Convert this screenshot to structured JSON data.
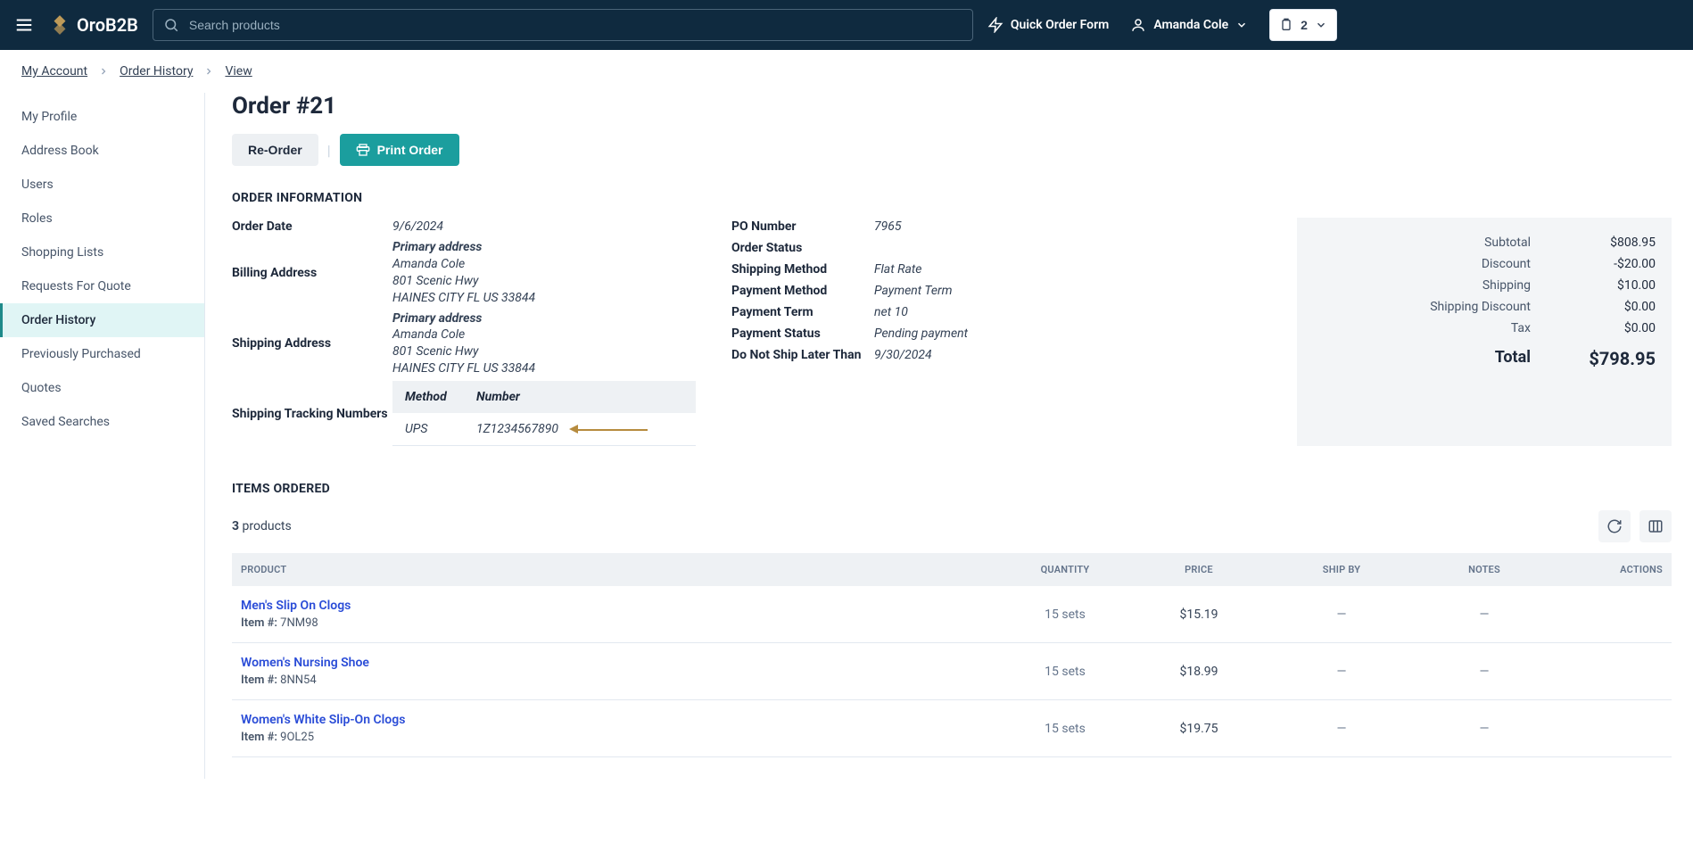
{
  "header": {
    "brand": "OroB2B",
    "search_placeholder": "Search products",
    "quick_order": "Quick Order Form",
    "user_name": "Amanda Cole",
    "cart_count": "2"
  },
  "breadcrumb": {
    "items": [
      "My Account",
      "Order History",
      "View"
    ]
  },
  "sidebar": {
    "items": [
      {
        "label": "My Profile"
      },
      {
        "label": "Address Book"
      },
      {
        "label": "Users"
      },
      {
        "label": "Roles"
      },
      {
        "label": "Shopping Lists"
      },
      {
        "label": "Requests For Quote"
      },
      {
        "label": "Order History",
        "active": true
      },
      {
        "label": "Previously Purchased"
      },
      {
        "label": "Quotes"
      },
      {
        "label": "Saved Searches"
      }
    ]
  },
  "page": {
    "title": "Order #21",
    "actions": {
      "reorder": "Re-Order",
      "print": "Print Order"
    }
  },
  "order_info": {
    "section_title": "ORDER INFORMATION",
    "left_col": {
      "order_date_label": "Order Date",
      "order_date": "9/6/2024",
      "billing_label": "Billing Address",
      "shipping_label": "Shipping Address",
      "tracking_label": "Shipping Tracking Numbers",
      "address": {
        "title": "Primary address",
        "name": "Amanda Cole",
        "line1": "801 Scenic Hwy",
        "line2": "HAINES CITY FL US 33844"
      }
    },
    "right_col": {
      "po_label": "PO Number",
      "po": "7965",
      "status_label": "Order Status",
      "status": "",
      "ship_method_label": "Shipping Method",
      "ship_method": "Flat Rate",
      "pay_method_label": "Payment Method",
      "pay_method": "Payment Term",
      "pay_term_label": "Payment Term",
      "pay_term": "net 10",
      "pay_status_label": "Payment Status",
      "pay_status": "Pending payment",
      "no_ship_label": "Do Not Ship Later Than",
      "no_ship": "9/30/2024"
    },
    "tracking": {
      "method_header": "Method",
      "number_header": "Number",
      "method": "UPS",
      "number": "1Z1234567890"
    }
  },
  "totals": {
    "subtotal_label": "Subtotal",
    "subtotal": "$808.95",
    "discount_label": "Discount",
    "discount": "-$20.00",
    "shipping_label": "Shipping",
    "shipping": "$10.00",
    "ship_discount_label": "Shipping Discount",
    "ship_discount": "$0.00",
    "tax_label": "Tax",
    "tax": "$0.00",
    "total_label": "Total",
    "total": "$798.95"
  },
  "items": {
    "section_title": "ITEMS ORDERED",
    "count": "3",
    "count_label": "products",
    "headers": {
      "product": "PRODUCT",
      "quantity": "QUANTITY",
      "price": "PRICE",
      "ship_by": "SHIP BY",
      "notes": "NOTES",
      "actions": "ACTIONS"
    },
    "sku_prefix": "Item #:",
    "rows": [
      {
        "name": "Men's Slip On Clogs",
        "sku": "7NM98",
        "qty": "15 sets",
        "price": "$15.19",
        "ship_by": "—",
        "notes": "—"
      },
      {
        "name": "Women's Nursing Shoe",
        "sku": "8NN54",
        "qty": "15 sets",
        "price": "$18.99",
        "ship_by": "—",
        "notes": "—"
      },
      {
        "name": "Women's White Slip-On Clogs",
        "sku": "9OL25",
        "qty": "15 sets",
        "price": "$19.75",
        "ship_by": "—",
        "notes": "—"
      }
    ]
  }
}
